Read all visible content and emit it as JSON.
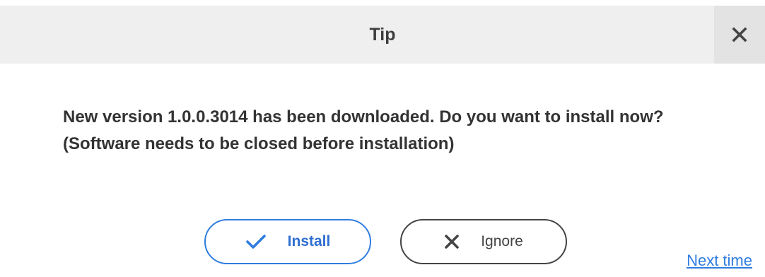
{
  "dialog": {
    "title": "Tip",
    "close_icon": "close-icon",
    "message": "New version 1.0.0.3014 has been downloaded. Do you want to install now? (Software needs to be closed before installation)",
    "install_label": "Install",
    "install_icon": "checkmark-icon",
    "ignore_label": "Ignore",
    "ignore_icon": "x-icon",
    "next_time_label": "Next time"
  },
  "colors": {
    "accent": "#2f7de0",
    "titlebar_bg": "#efefef",
    "text": "#333333"
  }
}
